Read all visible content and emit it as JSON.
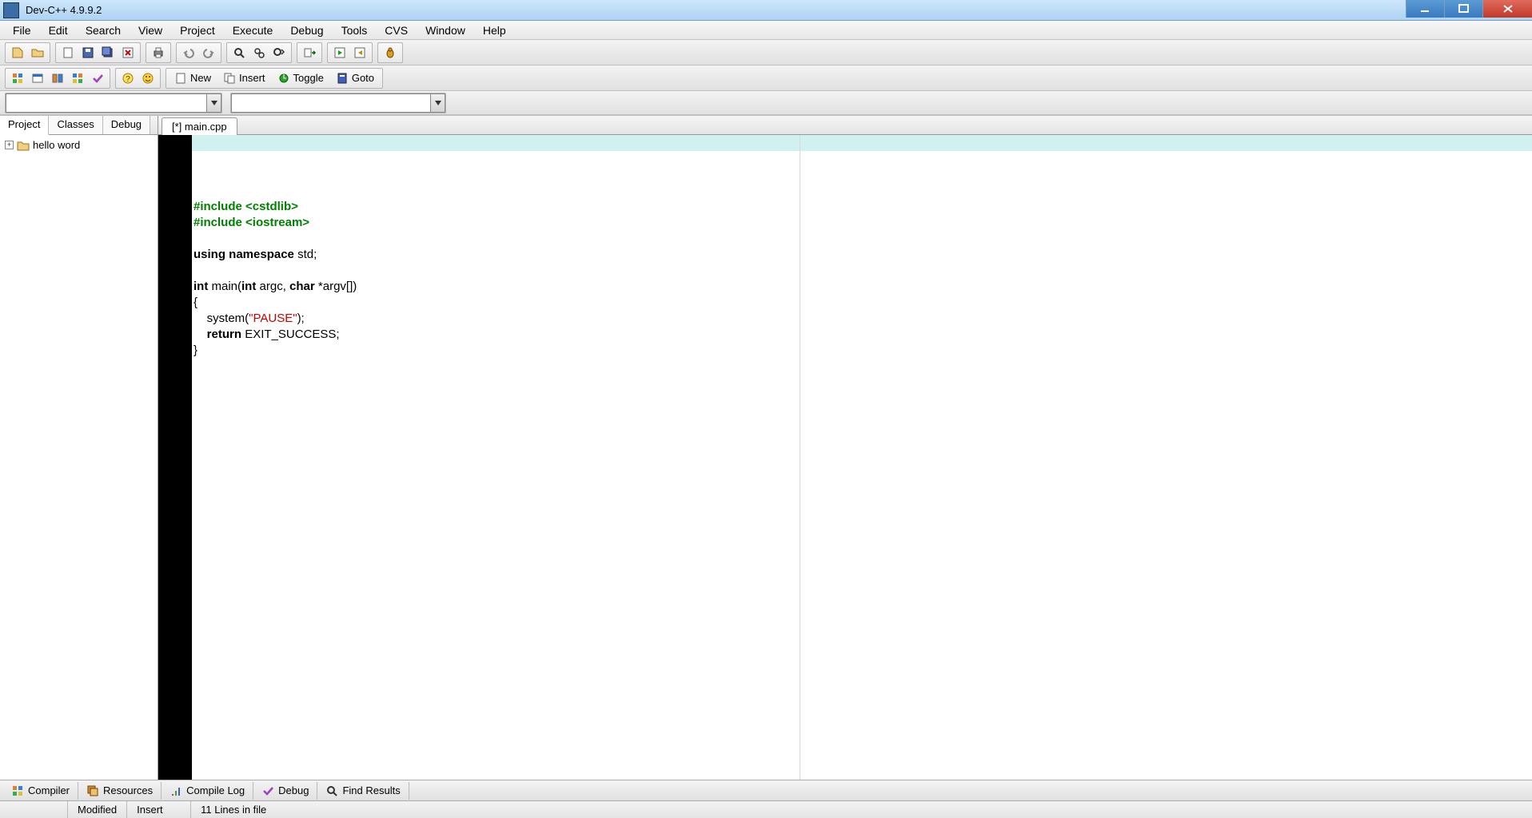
{
  "title": "Dev-C++ 4.9.9.2",
  "menu": [
    "File",
    "Edit",
    "Search",
    "View",
    "Project",
    "Execute",
    "Debug",
    "Tools",
    "CVS",
    "Window",
    "Help"
  ],
  "toolbar2_text_buttons": {
    "new": "New",
    "insert": "Insert",
    "toggle": "Toggle",
    "goto": "Goto"
  },
  "left_tabs": [
    "Project",
    "Classes",
    "Debug"
  ],
  "tree_root": "hello word",
  "file_tab": "[*] main.cpp",
  "code_lines": [
    {
      "tokens": [
        {
          "t": "#include <cstdlib>",
          "c": "kw-green"
        }
      ]
    },
    {
      "tokens": [
        {
          "t": "#include <iostream>",
          "c": "kw-green"
        }
      ]
    },
    {
      "tokens": [
        {
          "t": "",
          "c": ""
        }
      ]
    },
    {
      "tokens": [
        {
          "t": "using namespace ",
          "c": "kw-bold"
        },
        {
          "t": "std;",
          "c": ""
        }
      ]
    },
    {
      "tokens": [
        {
          "t": "",
          "c": ""
        }
      ]
    },
    {
      "tokens": [
        {
          "t": "int ",
          "c": "kw-bold"
        },
        {
          "t": "main(",
          "c": ""
        },
        {
          "t": "int ",
          "c": "kw-bold"
        },
        {
          "t": "argc, ",
          "c": ""
        },
        {
          "t": "char ",
          "c": "kw-bold"
        },
        {
          "t": "*argv[])",
          "c": ""
        }
      ]
    },
    {
      "tokens": [
        {
          "t": "{",
          "c": ""
        }
      ]
    },
    {
      "tokens": [
        {
          "t": "    system(",
          "c": ""
        },
        {
          "t": "\"PAUSE\"",
          "c": "str-red"
        },
        {
          "t": ");",
          "c": ""
        }
      ]
    },
    {
      "tokens": [
        {
          "t": "    ",
          "c": ""
        },
        {
          "t": "return ",
          "c": "kw-bold"
        },
        {
          "t": "EXIT_SUCCESS;",
          "c": ""
        }
      ]
    },
    {
      "tokens": [
        {
          "t": "}",
          "c": ""
        }
      ]
    }
  ],
  "bottom_tabs": [
    "Compiler",
    "Resources",
    "Compile Log",
    "Debug",
    "Find Results"
  ],
  "status": {
    "modified": "Modified",
    "insert": "Insert",
    "lines": "11 Lines in file"
  }
}
